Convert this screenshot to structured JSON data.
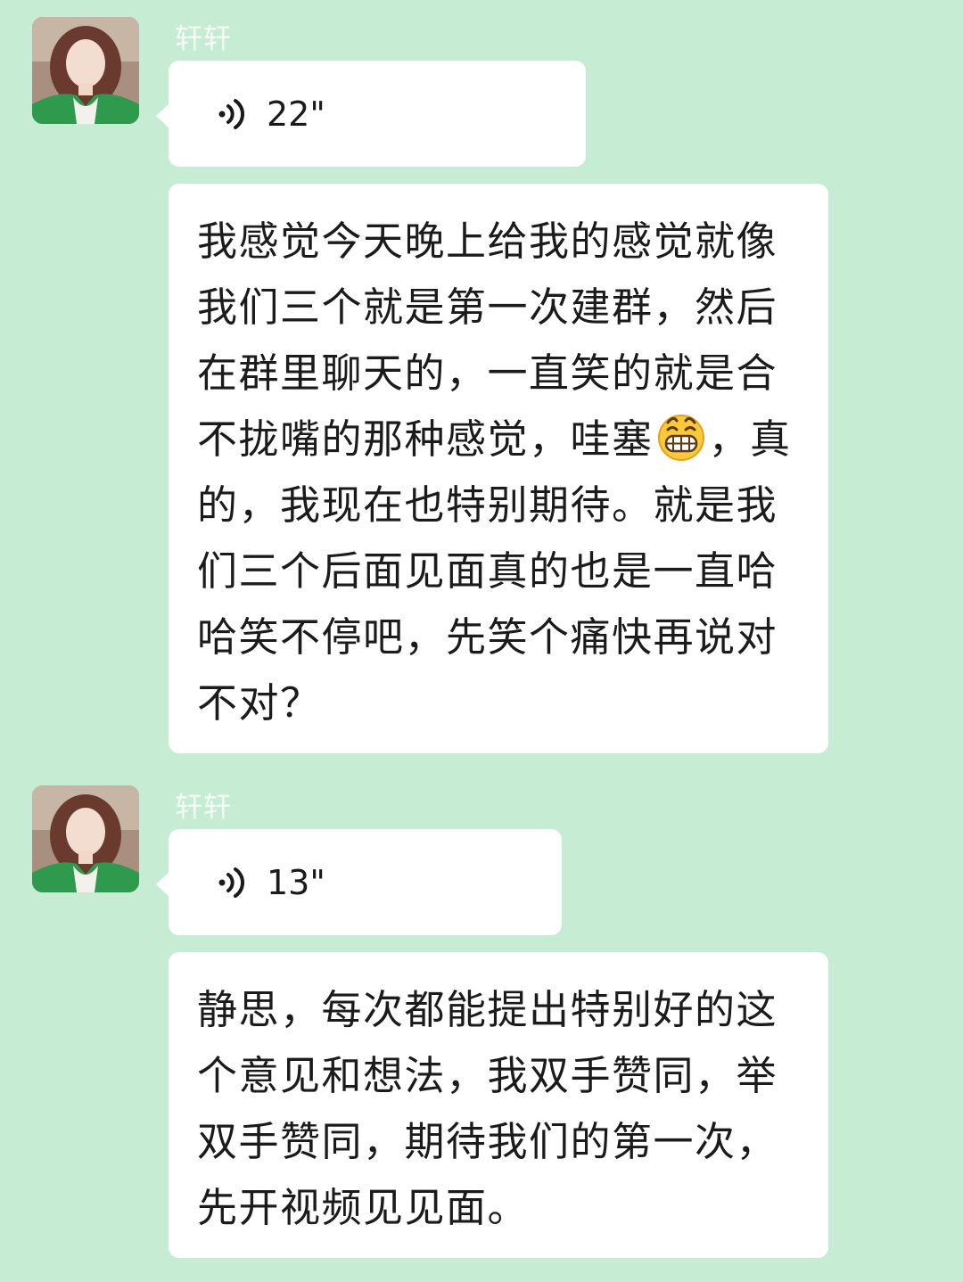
{
  "conversation": {
    "messages": [
      {
        "sender": "轩轩",
        "type": "voice",
        "duration": "22\""
      },
      {
        "type": "text",
        "text_before_emoji": "我感觉今天晚上给我的感觉就像我们三个就是第一次建群，然后在群里聊天的，一直笑的就是合不拢嘴的那种感觉，哇塞",
        "emoji": "grinning-face-emoji",
        "text_after_emoji": "，真的，我现在也特别期待。就是我们三个后面见面真的也是一直哈哈笑不停吧，先笑个痛快再说对不对？"
      },
      {
        "sender": "轩轩",
        "type": "voice",
        "duration": "13\""
      },
      {
        "type": "text",
        "text": "静思，每次都能提出特别好的这个意见和想法，我双手赞同，举双手赞同，期待我们的第一次，先开视频见见面。"
      }
    ]
  },
  "colors": {
    "background": "#c6edd3",
    "bubble": "#ffffff",
    "text": "#1b1b1b",
    "sender_name": "#f6fbf7"
  }
}
